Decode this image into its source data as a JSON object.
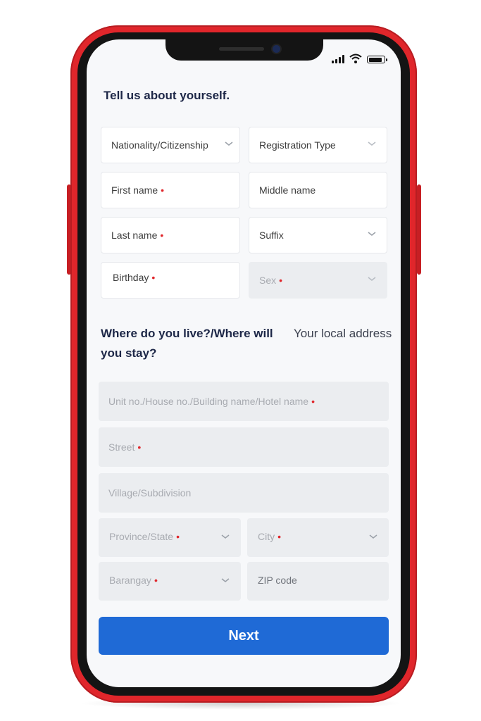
{
  "section1": {
    "title": "Tell us about yourself.",
    "fields": {
      "nationality": {
        "label": "Nationality/Citizenship",
        "required": ""
      },
      "registration_type": {
        "label": "Registration Type",
        "required": ""
      },
      "first_name": {
        "label": "First name",
        "required": "•"
      },
      "middle_name": {
        "label": "Middle name",
        "required": ""
      },
      "last_name": {
        "label": "Last name",
        "required": "•"
      },
      "suffix": {
        "label": "Suffix",
        "required": ""
      },
      "birthday": {
        "label": "Birthday",
        "required": "•"
      },
      "sex": {
        "label": "Sex",
        "required": "•"
      }
    }
  },
  "section2": {
    "title": "Where do you live?/Where will you stay?",
    "subtitle": "Your local address",
    "fields": {
      "unit": {
        "label": "Unit no./House no./Building name/Hotel name",
        "required": "•"
      },
      "street": {
        "label": "Street",
        "required": "•"
      },
      "village": {
        "label": "Village/Subdivision",
        "required": ""
      },
      "province": {
        "label": "Province/State",
        "required": "•"
      },
      "city": {
        "label": "City",
        "required": "•"
      },
      "barangay": {
        "label": "Barangay",
        "required": "•"
      },
      "zip": {
        "label": "ZIP code",
        "required": ""
      }
    }
  },
  "next_button": {
    "label": "Next"
  },
  "icons": {
    "dropdown": "chevron-down-icon",
    "signal": "signal-bars-icon",
    "wifi": "wifi-icon",
    "battery": "battery-icon"
  },
  "colors": {
    "phone_frame": "#e0262b",
    "primary_button": "#1f6ad6",
    "heading": "#1d2747",
    "required_marker": "#e0262b",
    "disabled_field": "#ebedf0"
  }
}
